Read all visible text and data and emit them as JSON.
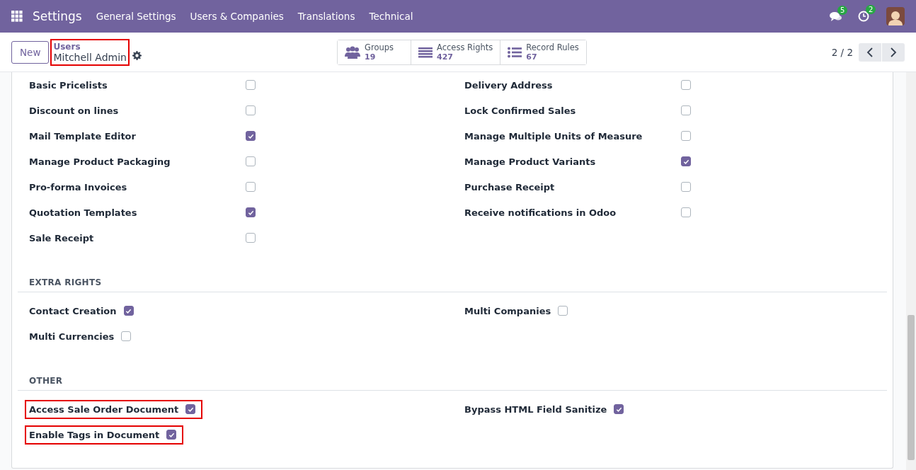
{
  "navbar": {
    "app_name": "Settings",
    "menus": [
      "General Settings",
      "Users & Companies",
      "Translations",
      "Technical"
    ],
    "messages_badge": "5",
    "activities_badge": "2"
  },
  "control_panel": {
    "new_button": "New",
    "breadcrumb": {
      "parent": "Users",
      "current": "Mitchell Admin",
      "highlighted": true
    },
    "smart_buttons": [
      {
        "kind": "groups",
        "label": "Groups",
        "count": "19"
      },
      {
        "kind": "list",
        "label": "Access Rights",
        "count": "427"
      },
      {
        "kind": "bullets",
        "label": "Record Rules",
        "count": "67"
      }
    ],
    "pager": "2 / 2"
  },
  "sections": [
    {
      "left": [
        {
          "label": "Basic Pricelists",
          "checked": false,
          "highlighted": false
        },
        {
          "label": "Discount on lines",
          "checked": false,
          "highlighted": false
        },
        {
          "label": "Mail Template Editor",
          "checked": true,
          "highlighted": false
        },
        {
          "label": "Manage Product Packaging",
          "checked": false,
          "highlighted": false
        },
        {
          "label": "Pro-forma Invoices",
          "checked": false,
          "highlighted": false
        },
        {
          "label": "Quotation Templates",
          "checked": true,
          "highlighted": false
        },
        {
          "label": "Sale Receipt",
          "checked": false,
          "highlighted": false
        }
      ],
      "right": [
        {
          "label": "Delivery Address",
          "checked": false,
          "highlighted": false
        },
        {
          "label": "Lock Confirmed Sales",
          "checked": false,
          "highlighted": false
        },
        {
          "label": "Manage Multiple Units of Measure",
          "checked": false,
          "highlighted": false
        },
        {
          "label": "Manage Product Variants",
          "checked": true,
          "highlighted": false
        },
        {
          "label": "Purchase Receipt",
          "checked": false,
          "highlighted": false
        },
        {
          "label": "Receive notifications in Odoo",
          "checked": false,
          "highlighted": false
        }
      ]
    },
    {
      "title": "EXTRA RIGHTS",
      "left": [
        {
          "label": "Contact Creation",
          "checked": true,
          "highlighted": false
        },
        {
          "label": "Multi Currencies",
          "checked": false,
          "highlighted": false
        }
      ],
      "right": [
        {
          "label": "Multi Companies",
          "checked": false,
          "highlighted": false
        }
      ]
    },
    {
      "title": "OTHER",
      "left": [
        {
          "label": "Access Sale Order Document",
          "checked": true,
          "highlighted": true
        },
        {
          "label": "Enable Tags in Document",
          "checked": true,
          "highlighted": true
        }
      ],
      "right": [
        {
          "label": "Bypass HTML Field Sanitize",
          "checked": true,
          "highlighted": false
        }
      ]
    }
  ]
}
